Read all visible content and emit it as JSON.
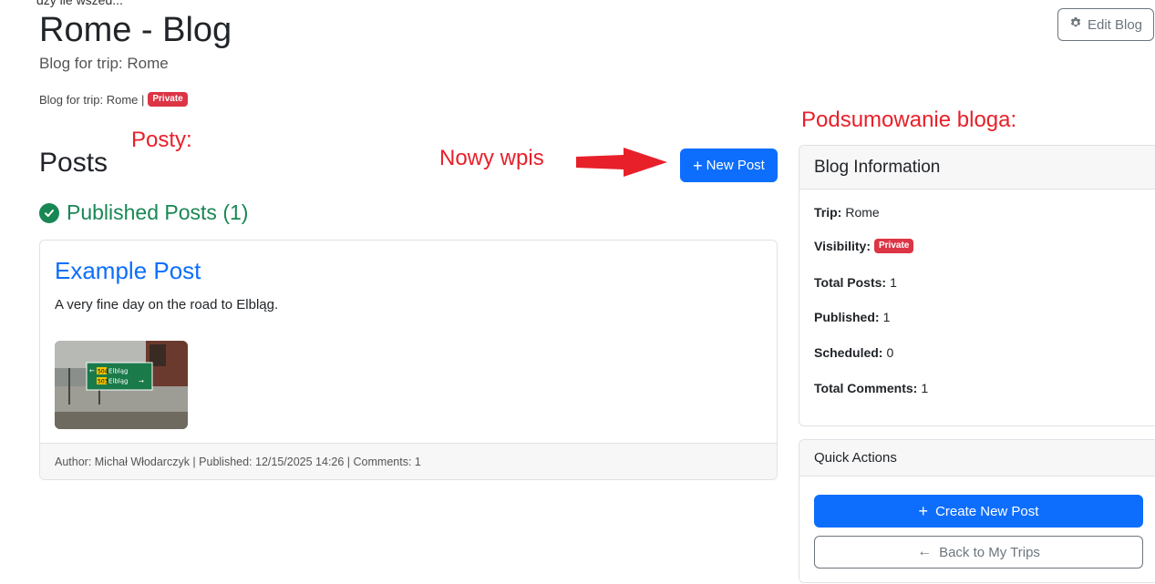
{
  "top_note": "dzy ile wszed...",
  "blog": {
    "title": "Rome - Blog",
    "subtitle": "Blog for trip: Rome",
    "meta_prefix": "Blog for trip: Rome |",
    "visibility_badge": "Private",
    "edit_label": "Edit Blog"
  },
  "annotations": {
    "posts": "Posty:",
    "new_entry": "Nowy wpis",
    "summary": "Podsumowanie bloga:"
  },
  "posts_section": {
    "heading": "Posts",
    "new_post_label": "New Post",
    "published_heading": "Published Posts (1)"
  },
  "post": {
    "title": "Example Post",
    "excerpt": "A very fine day on the road to Elbląg.",
    "footer": "Author: Michał Włodarczyk | Published: 12/15/2025 14:26 | Comments: 1",
    "sign_line1_num": "504",
    "sign_line1_text": "Elbląg",
    "sign_line2_num": "503",
    "sign_line2_text": "Elbląg"
  },
  "blog_info": {
    "header": "Blog Information",
    "trip_label": "Trip:",
    "trip_value": "Rome",
    "visibility_label": "Visibility:",
    "visibility_value": "Private",
    "total_posts_label": "Total Posts:",
    "total_posts_value": "1",
    "published_label": "Published:",
    "published_value": "1",
    "scheduled_label": "Scheduled:",
    "scheduled_value": "0",
    "comments_label": "Total Comments:",
    "comments_value": "1"
  },
  "quick_actions": {
    "header": "Quick Actions",
    "create_label": "Create New Post",
    "back_label": "Back to My Trips"
  },
  "colors": {
    "primary": "#0d6efd",
    "success": "#198754",
    "danger": "#dc3545",
    "annotation": "#e8202a"
  }
}
